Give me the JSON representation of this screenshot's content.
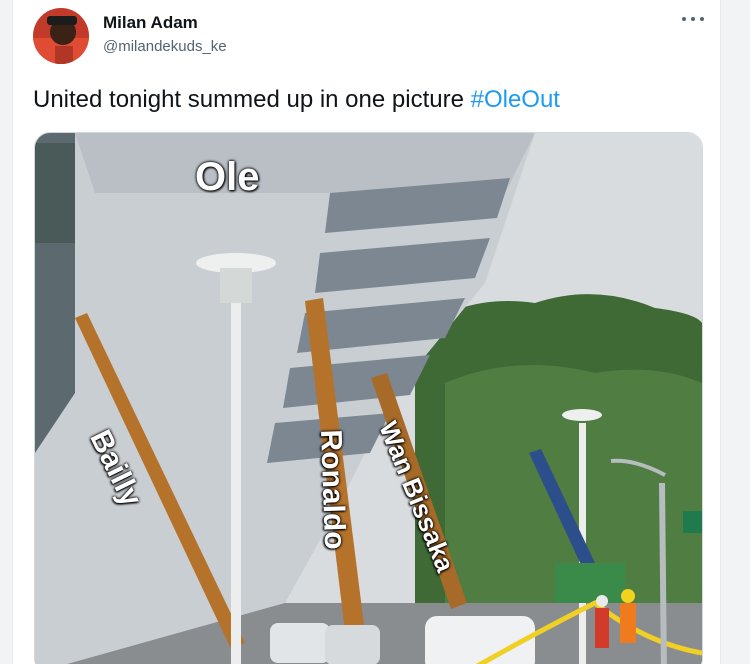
{
  "tweet": {
    "author_name": "Milan Adam",
    "author_handle": "@milandekuds_ke",
    "text": "United tonight summed up in one picture ",
    "hashtag": "#OleOut"
  },
  "meme": {
    "captions": {
      "top": "Ole",
      "left_beam": "Bailly",
      "middle_beam": "Ronaldo",
      "right_beam": "Wan Bissaka"
    }
  },
  "colors": {
    "link": "#1d9bf0",
    "text": "#0f1419",
    "secondary": "#536471"
  },
  "icons": {
    "more": "more-options-icon"
  }
}
